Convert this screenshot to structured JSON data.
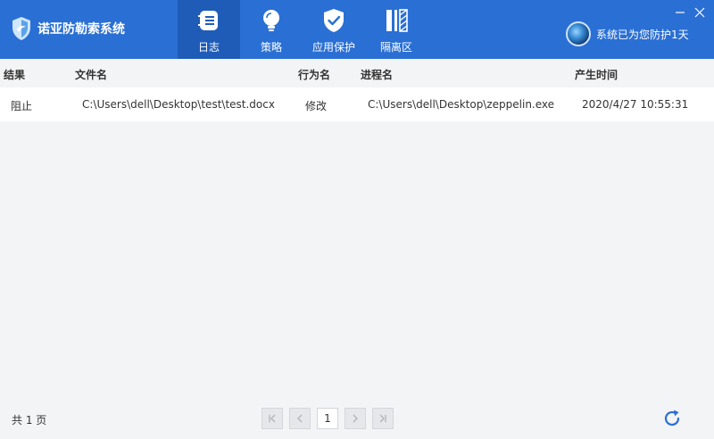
{
  "app": {
    "title": "诺亚防勒索系统",
    "status_text": "系统已为您防护1天"
  },
  "nav": {
    "items": [
      {
        "label": "日志",
        "icon": "log-icon",
        "active": true
      },
      {
        "label": "策略",
        "icon": "lightbulb-icon",
        "active": false
      },
      {
        "label": "应用保护",
        "icon": "shield-check-icon",
        "active": false
      },
      {
        "label": "隔离区",
        "icon": "quarantine-icon",
        "active": false
      }
    ]
  },
  "table": {
    "columns": [
      "结果",
      "文件名",
      "行为名",
      "进程名",
      "产生时间"
    ],
    "rows": [
      {
        "result": "阻止",
        "file": "C:\\Users\\dell\\Desktop\\test\\test.docx",
        "action": "修改",
        "process": "C:\\Users\\dell\\Desktop\\zeppelin.exe",
        "time": "2020/4/27 10:55:31"
      }
    ]
  },
  "footer": {
    "total_text": "共 1 页",
    "current_page": "1"
  },
  "colors": {
    "header_bg": "#2a6fd4",
    "nav_active_bg": "#1f5cb8",
    "body_bg": "#f3f4f6",
    "accent": "#2a6fd4"
  }
}
